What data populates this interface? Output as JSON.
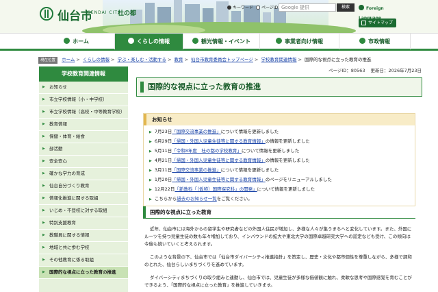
{
  "header": {
    "logo_name": "仙台市",
    "logo_sub": "SENDAI CITY",
    "logo_mori": "杜の都",
    "search": {
      "radio_keyword": "キーワード",
      "radio_page_id": "ページID",
      "placeholder": "Google 提供",
      "button_label": "検索"
    },
    "foreign_language": "Foreign Language",
    "sitemap": "サイトマップ"
  },
  "nav": {
    "items": [
      {
        "label": "ホーム",
        "icon": "home-icon"
      },
      {
        "label": "くらしの情報",
        "icon": "family-icon"
      },
      {
        "label": "観光情報・イベント",
        "icon": "tourism-icon"
      },
      {
        "label": "事業者向け情報",
        "icon": "business-icon"
      },
      {
        "label": "市政情報",
        "icon": "city-hall-icon"
      }
    ]
  },
  "breadcrumb": {
    "label": "現在位置",
    "items": [
      "ホーム",
      "くらしの情報",
      "学ぶ・楽しむ・活動する",
      "教育",
      "仙台市教育委員会トップページ",
      "学校教育関連情報",
      "国際的な視点に立った教育の推進"
    ]
  },
  "page_meta": {
    "page_id": "ページID：80563",
    "updated": "更新日：2026年7月23日"
  },
  "sidebar": {
    "title": "学校教育関連情報",
    "items": [
      "お知らせ",
      "市立学校情報（小・中学校）",
      "市立学校情報（高校・中等教育学校）",
      "教育情報",
      "保健・体育・給食",
      "部活動",
      "安全安心",
      "確かな学力の育成",
      "仙台自分づくり教育",
      "情報化推進に関する取組",
      "いじめ・不登校に対する取組",
      "特別支援教育",
      "教職員に関する情報",
      "地域と共に歩む学校",
      "その他教育に係る取組",
      "国際的な視点に立った教育の推進"
    ]
  },
  "main": {
    "title": "国際的な視点に立った教育の推進",
    "notice": {
      "heading": "お知らせ",
      "items": [
        {
          "date": "7月23日",
          "link": "「国際交流事業の推進」",
          "suffix": "について情報を更新しました"
        },
        {
          "date": "6月29日",
          "link": "「帰国・外国人児童生徒等に関する教育情報」",
          "suffix": "の情報を更新しました"
        },
        {
          "date": "5月11日",
          "link": "「令和8年度　杜の都の学校教育」",
          "suffix": "について情報を更新しました"
        },
        {
          "date": "4月21日",
          "link": "「帰国・外国人児童生徒等に関する教育情報」",
          "suffix": "の情報を更新しました"
        },
        {
          "date": "3月11日",
          "link": "「国際交流事業の推進」",
          "suffix": "について情報を更新しました"
        },
        {
          "date": "1月20日",
          "link": "「帰国・外国人児童生徒等に関する教育情報」",
          "suffix": "のページをリニューアルしました"
        },
        {
          "date": "12月22日",
          "link": "「新教科「（仮称）国際探究科」の開発」",
          "suffix": "について情報を更新しました"
        }
      ],
      "past_prefix": "こちらから",
      "past_link": "過去のお知らせ一覧",
      "past_suffix": "をご覧ください。"
    },
    "section_heading": "国際的な視点に立った教育",
    "paragraphs": [
      "近年、仙台市には海外からの留学生や研究者などの外国人住民が増加し、多様な人々が集うまちへと変化しています。また、外国にルーツを持つ児童生徒の数も年々増加しており、インバウンドの拡大や東北大学の国際卓越研究大学への認定なども受け、この傾向は今後も続いていくと考えられます。",
      "このような背景の下、仙台市では「仙台市ダイバーシティ推進指針」を策定し、歴史・文化や都市個性を尊重しながら、多様で調和のとれた、仙台らしいまちづくりを進めています。",
      "ダイバーシティまちづくりの取り組みと連動し、仙台市では、児童生徒が多様な価値観に触れ、柔軟な思考や国際感覚を育むことができるよう、「国際的な視点に立った教育」を推進していきます。"
    ]
  }
}
